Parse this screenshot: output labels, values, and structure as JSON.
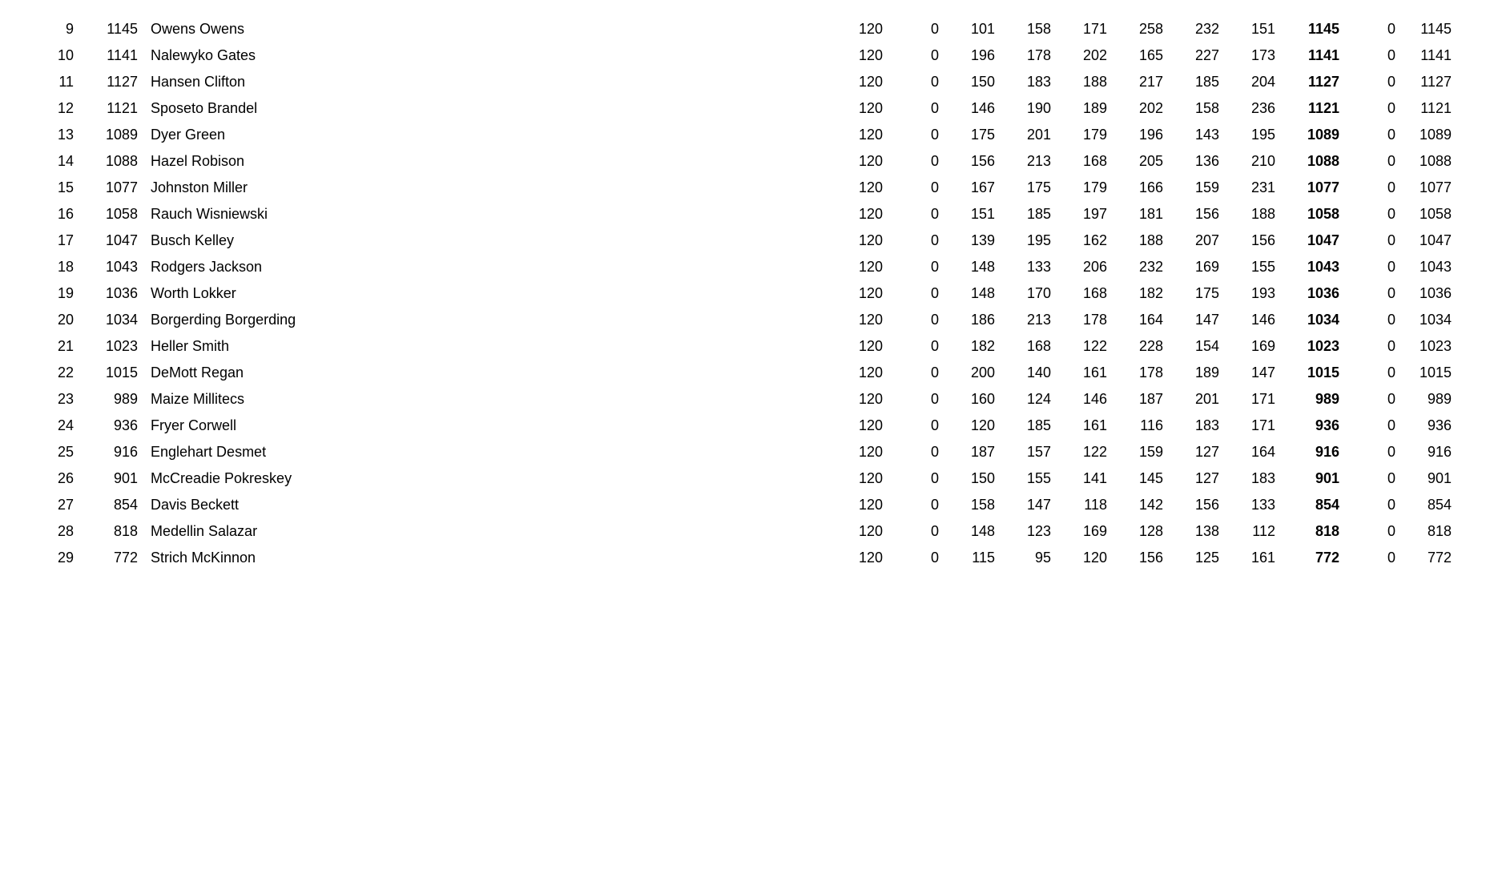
{
  "table": {
    "rows": [
      {
        "rank": "9",
        "score": "1145",
        "name": "Owens Owens",
        "g1": "120",
        "g2": "0",
        "g3": "101",
        "g4": "158",
        "g5": "171",
        "g6": "258",
        "g7": "232",
        "g8": "151",
        "total_bold": "1145",
        "x1": "0",
        "x2": "1145"
      },
      {
        "rank": "10",
        "score": "1141",
        "name": "Nalewyko Gates",
        "g1": "120",
        "g2": "0",
        "g3": "196",
        "g4": "178",
        "g5": "202",
        "g6": "165",
        "g7": "227",
        "g8": "173",
        "total_bold": "1141",
        "x1": "0",
        "x2": "1141"
      },
      {
        "rank": "11",
        "score": "1127",
        "name": "Hansen Clifton",
        "g1": "120",
        "g2": "0",
        "g3": "150",
        "g4": "183",
        "g5": "188",
        "g6": "217",
        "g7": "185",
        "g8": "204",
        "total_bold": "1127",
        "x1": "0",
        "x2": "1127"
      },
      {
        "rank": "12",
        "score": "1121",
        "name": "Sposeto Brandel",
        "g1": "120",
        "g2": "0",
        "g3": "146",
        "g4": "190",
        "g5": "189",
        "g6": "202",
        "g7": "158",
        "g8": "236",
        "total_bold": "1121",
        "x1": "0",
        "x2": "1121"
      },
      {
        "rank": "13",
        "score": "1089",
        "name": "Dyer Green",
        "g1": "120",
        "g2": "0",
        "g3": "175",
        "g4": "201",
        "g5": "179",
        "g6": "196",
        "g7": "143",
        "g8": "195",
        "total_bold": "1089",
        "x1": "0",
        "x2": "1089"
      },
      {
        "rank": "14",
        "score": "1088",
        "name": "Hazel Robison",
        "g1": "120",
        "g2": "0",
        "g3": "156",
        "g4": "213",
        "g5": "168",
        "g6": "205",
        "g7": "136",
        "g8": "210",
        "total_bold": "1088",
        "x1": "0",
        "x2": "1088"
      },
      {
        "rank": "15",
        "score": "1077",
        "name": "Johnston Miller",
        "g1": "120",
        "g2": "0",
        "g3": "167",
        "g4": "175",
        "g5": "179",
        "g6": "166",
        "g7": "159",
        "g8": "231",
        "total_bold": "1077",
        "x1": "0",
        "x2": "1077"
      },
      {
        "rank": "16",
        "score": "1058",
        "name": "Rauch Wisniewski",
        "g1": "120",
        "g2": "0",
        "g3": "151",
        "g4": "185",
        "g5": "197",
        "g6": "181",
        "g7": "156",
        "g8": "188",
        "total_bold": "1058",
        "x1": "0",
        "x2": "1058"
      },
      {
        "rank": "17",
        "score": "1047",
        "name": "Busch Kelley",
        "g1": "120",
        "g2": "0",
        "g3": "139",
        "g4": "195",
        "g5": "162",
        "g6": "188",
        "g7": "207",
        "g8": "156",
        "total_bold": "1047",
        "x1": "0",
        "x2": "1047"
      },
      {
        "rank": "18",
        "score": "1043",
        "name": "Rodgers Jackson",
        "g1": "120",
        "g2": "0",
        "g3": "148",
        "g4": "133",
        "g5": "206",
        "g6": "232",
        "g7": "169",
        "g8": "155",
        "total_bold": "1043",
        "x1": "0",
        "x2": "1043"
      },
      {
        "rank": "19",
        "score": "1036",
        "name": "Worth Lokker",
        "g1": "120",
        "g2": "0",
        "g3": "148",
        "g4": "170",
        "g5": "168",
        "g6": "182",
        "g7": "175",
        "g8": "193",
        "total_bold": "1036",
        "x1": "0",
        "x2": "1036"
      },
      {
        "rank": "20",
        "score": "1034",
        "name": "Borgerding Borgerding",
        "g1": "120",
        "g2": "0",
        "g3": "186",
        "g4": "213",
        "g5": "178",
        "g6": "164",
        "g7": "147",
        "g8": "146",
        "total_bold": "1034",
        "x1": "0",
        "x2": "1034"
      },
      {
        "rank": "21",
        "score": "1023",
        "name": "Heller Smith",
        "g1": "120",
        "g2": "0",
        "g3": "182",
        "g4": "168",
        "g5": "122",
        "g6": "228",
        "g7": "154",
        "g8": "169",
        "total_bold": "1023",
        "x1": "0",
        "x2": "1023"
      },
      {
        "rank": "22",
        "score": "1015",
        "name": "DeMott Regan",
        "g1": "120",
        "g2": "0",
        "g3": "200",
        "g4": "140",
        "g5": "161",
        "g6": "178",
        "g7": "189",
        "g8": "147",
        "total_bold": "1015",
        "x1": "0",
        "x2": "1015"
      },
      {
        "rank": "23",
        "score": "989",
        "name": "Maize Millitecs",
        "g1": "120",
        "g2": "0",
        "g3": "160",
        "g4": "124",
        "g5": "146",
        "g6": "187",
        "g7": "201",
        "g8": "171",
        "total_bold": "989",
        "x1": "0",
        "x2": "989"
      },
      {
        "rank": "24",
        "score": "936",
        "name": "Fryer Corwell",
        "g1": "120",
        "g2": "0",
        "g3": "120",
        "g4": "185",
        "g5": "161",
        "g6": "116",
        "g7": "183",
        "g8": "171",
        "total_bold": "936",
        "x1": "0",
        "x2": "936"
      },
      {
        "rank": "25",
        "score": "916",
        "name": "Englehart Desmet",
        "g1": "120",
        "g2": "0",
        "g3": "187",
        "g4": "157",
        "g5": "122",
        "g6": "159",
        "g7": "127",
        "g8": "164",
        "total_bold": "916",
        "x1": "0",
        "x2": "916"
      },
      {
        "rank": "26",
        "score": "901",
        "name": "McCreadie Pokreskey",
        "g1": "120",
        "g2": "0",
        "g3": "150",
        "g4": "155",
        "g5": "141",
        "g6": "145",
        "g7": "127",
        "g8": "183",
        "total_bold": "901",
        "x1": "0",
        "x2": "901"
      },
      {
        "rank": "27",
        "score": "854",
        "name": "Davis Beckett",
        "g1": "120",
        "g2": "0",
        "g3": "158",
        "g4": "147",
        "g5": "118",
        "g6": "142",
        "g7": "156",
        "g8": "133",
        "total_bold": "854",
        "x1": "0",
        "x2": "854"
      },
      {
        "rank": "28",
        "score": "818",
        "name": "Medellin Salazar",
        "g1": "120",
        "g2": "0",
        "g3": "148",
        "g4": "123",
        "g5": "169",
        "g6": "128",
        "g7": "138",
        "g8": "112",
        "total_bold": "818",
        "x1": "0",
        "x2": "818"
      },
      {
        "rank": "29",
        "score": "772",
        "name": "Strich McKinnon",
        "g1": "120",
        "g2": "0",
        "g3": "115",
        "g4": "95",
        "g5": "120",
        "g6": "156",
        "g7": "125",
        "g8": "161",
        "total_bold": "772",
        "x1": "0",
        "x2": "772"
      }
    ]
  }
}
